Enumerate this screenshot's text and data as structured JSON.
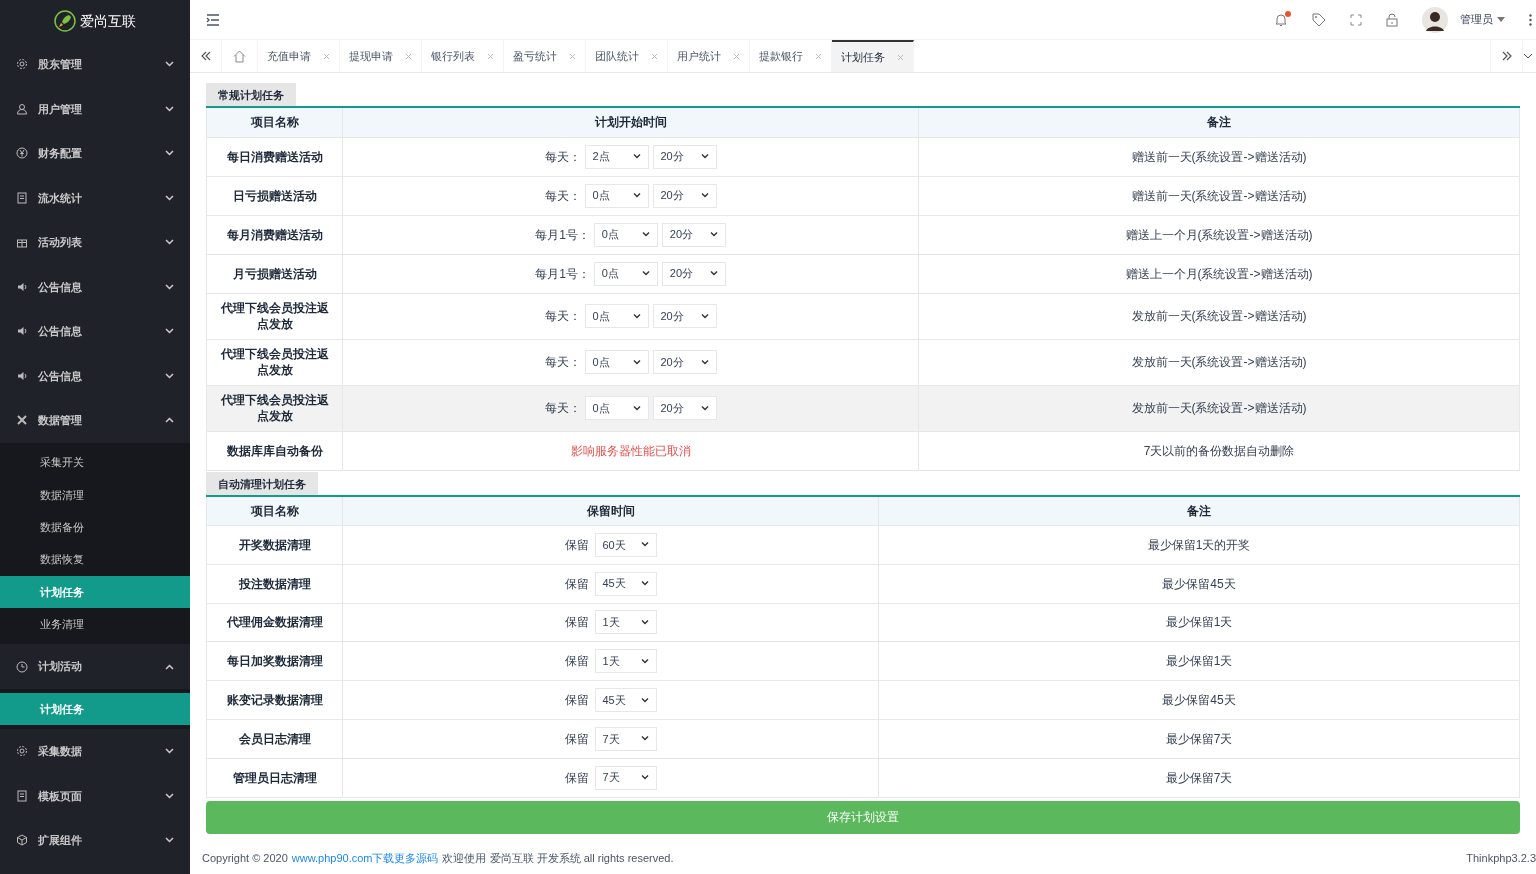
{
  "brand": "爱尚互联",
  "sidebar": {
    "items": [
      {
        "label": "股东管理",
        "expanded": false
      },
      {
        "label": "用户管理",
        "expanded": false
      },
      {
        "label": "财务配置",
        "expanded": false
      },
      {
        "label": "流水统计",
        "expanded": false
      },
      {
        "label": "活动列表",
        "expanded": false
      },
      {
        "label": "公告信息",
        "expanded": false
      },
      {
        "label": "公告信息",
        "expanded": false
      },
      {
        "label": "公告信息",
        "expanded": false
      },
      {
        "label": "数据管理",
        "expanded": true,
        "children": [
          {
            "label": "采集开关",
            "selected": false
          },
          {
            "label": "数据清理",
            "selected": false
          },
          {
            "label": "数据备份",
            "selected": false
          },
          {
            "label": "数据恢复",
            "selected": false
          },
          {
            "label": "计划任务",
            "selected": true
          },
          {
            "label": "业务清理",
            "selected": false
          }
        ]
      },
      {
        "label": "计划活动",
        "expanded": true,
        "children": [
          {
            "label": "计划任务",
            "selected": true
          }
        ]
      },
      {
        "label": "采集数据",
        "expanded": false
      },
      {
        "label": "模板页面",
        "expanded": false
      },
      {
        "label": "扩展组件",
        "expanded": false
      }
    ]
  },
  "header": {
    "user": "管理员",
    "notification": true
  },
  "tabs": [
    {
      "label": "充值申请",
      "selected": false
    },
    {
      "label": "提现申请",
      "selected": false
    },
    {
      "label": "银行列表",
      "selected": false
    },
    {
      "label": "盈亏统计",
      "selected": false
    },
    {
      "label": "团队统计",
      "selected": false
    },
    {
      "label": "用户统计",
      "selected": false
    },
    {
      "label": "提款银行",
      "selected": false
    },
    {
      "label": "计划任务",
      "selected": true
    }
  ],
  "regular": {
    "title": "常规计划任务",
    "columns": [
      "项目名称",
      "计划开始时间",
      "备注"
    ],
    "rows": [
      {
        "kind": "time",
        "name": "每日消费赠送活动",
        "prefix": "每天：",
        "hour": "2点",
        "minute": "20分",
        "note": "赠送前一天(系统设置->赠送活动)"
      },
      {
        "kind": "time",
        "name": "日亏损赠送活动",
        "prefix": "每天：",
        "hour": "0点",
        "minute": "20分",
        "note": "赠送前一天(系统设置->赠送活动)"
      },
      {
        "kind": "time",
        "name": "每月消费赠送活动",
        "prefix": "每月1号：",
        "hour": "0点",
        "minute": "20分",
        "note": "赠送上一个月(系统设置->赠送活动)"
      },
      {
        "kind": "time",
        "name": "月亏损赠送活动",
        "prefix": "每月1号：",
        "hour": "0点",
        "minute": "20分",
        "note": "赠送上一个月(系统设置->赠送活动)"
      },
      {
        "kind": "time",
        "name": "代理下线会员投注返点发放",
        "prefix": "每天：",
        "hour": "0点",
        "minute": "20分",
        "note": "发放前一天(系统设置->赠送活动)"
      },
      {
        "kind": "time",
        "name": "代理下线会员投注返点发放",
        "prefix": "每天：",
        "hour": "0点",
        "minute": "20分",
        "note": "发放前一天(系统设置->赠送活动)"
      },
      {
        "kind": "time",
        "name": "代理下线会员投注返点发放",
        "prefix": "每天：",
        "hour": "0点",
        "minute": "20分",
        "note": "发放前一天(系统设置->赠送活动)",
        "highlighted": true
      },
      {
        "kind": "notice",
        "name": "数据库库自动备份",
        "notice": "影响服务器性能已取消",
        "note": "7天以前的备份数据自动删除"
      }
    ]
  },
  "cleanup": {
    "title": "自动清理计划任务",
    "columns": [
      "项目名称",
      "保留时间",
      "备注"
    ],
    "rows": [
      {
        "name": "开奖数据清理",
        "prefix": "保留",
        "value": "60天",
        "note": "最少保留1天的开奖"
      },
      {
        "name": "投注数据清理",
        "prefix": "保留",
        "value": "45天",
        "note": "最少保留45天"
      },
      {
        "name": "代理佣金数据清理",
        "prefix": "保留",
        "value": "1天",
        "note": "最少保留1天"
      },
      {
        "name": "每日加奖数据清理",
        "prefix": "保留",
        "value": "1天",
        "note": "最少保留1天"
      },
      {
        "name": "账变记录数据清理",
        "prefix": "保留",
        "value": "45天",
        "note": "最少保留45天"
      },
      {
        "name": "会员日志清理",
        "prefix": "保留",
        "value": "7天",
        "note": "最少保留7天"
      },
      {
        "name": "管理员日志清理",
        "prefix": "保留",
        "value": "7天",
        "note": "最少保留7天"
      }
    ]
  },
  "save_button": "保存计划设置",
  "footer": {
    "copyright": "Copyright © 2020",
    "link": "www.php90.com下载更多源码",
    "rest": "欢迎使用 爱尚互联 开发系统 all rights reserved.",
    "version": "Thinkphp3.2.3"
  }
}
